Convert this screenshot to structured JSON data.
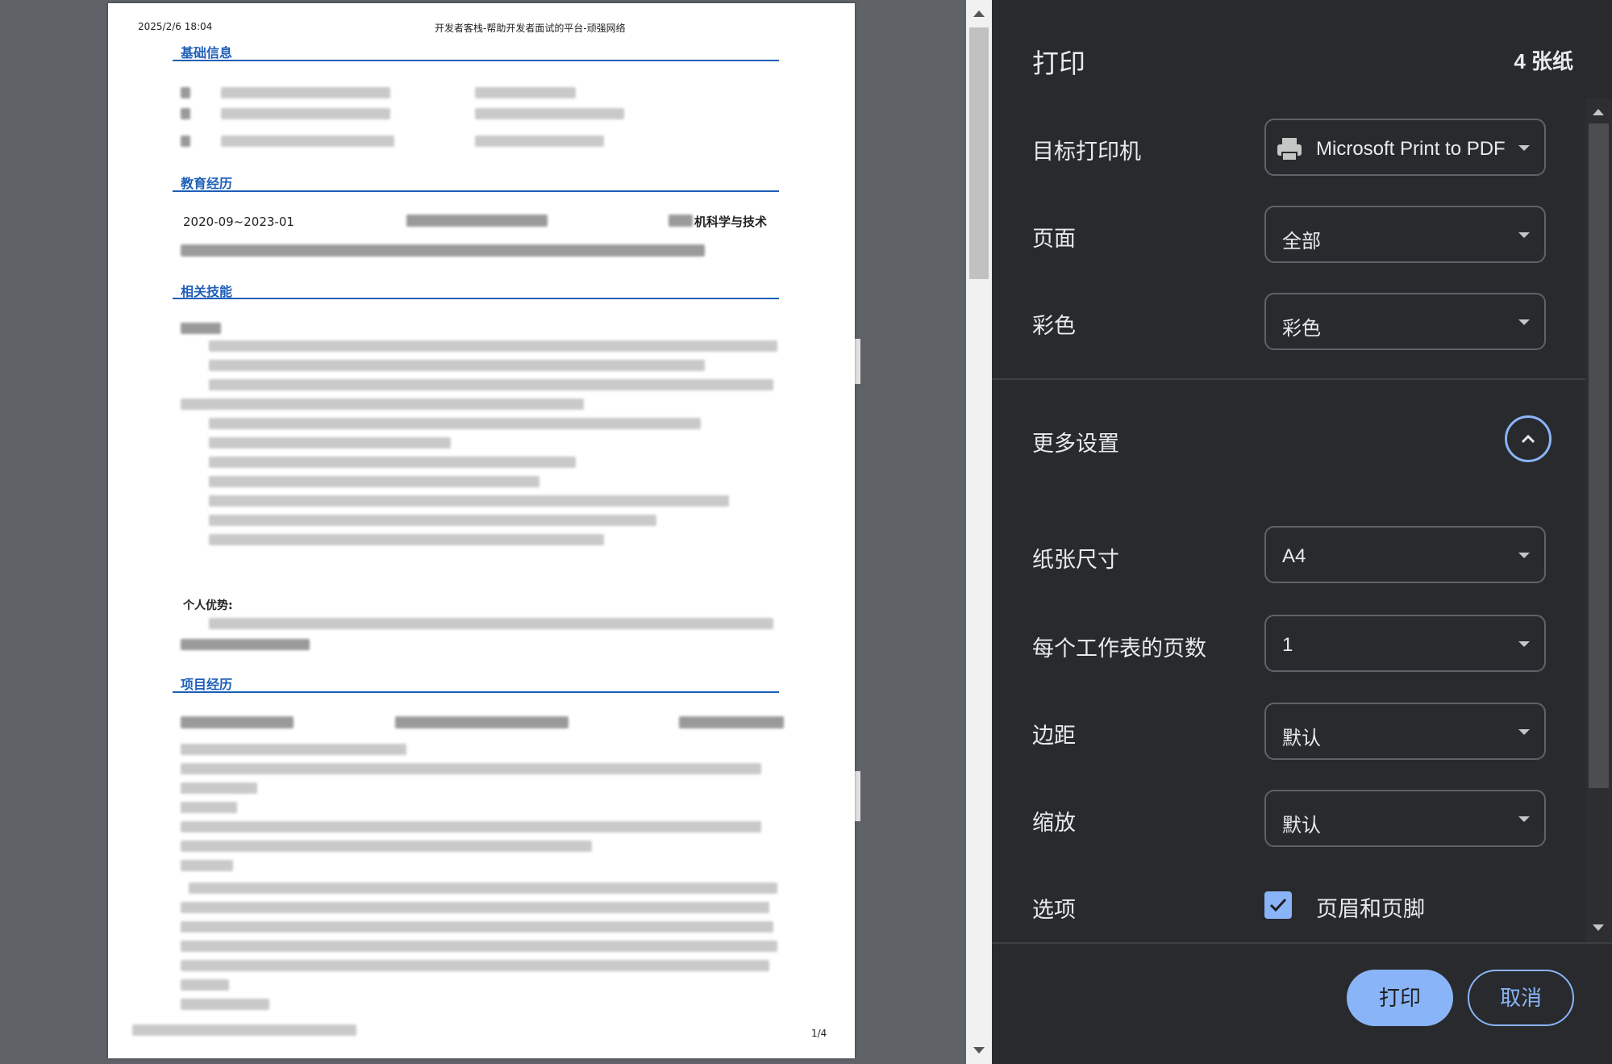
{
  "preview": {
    "header_date": "2025/2/6 18:04",
    "header_title": "开发者客栈-帮助开发者面试的平台-顽强网络",
    "page_number": "1/4",
    "sections": {
      "basic": "基础信息",
      "education": "教育经历",
      "skills": "相关技能",
      "projects": "项目经历"
    },
    "edu_date": "2020-09~2023-01",
    "edu_major": "机科学与技术",
    "advantage_label": "个人优势:"
  },
  "panel": {
    "title": "打印",
    "sheet_count": "4 张纸",
    "destination": {
      "label": "目标打印机",
      "value": "Microsoft Print to PDF",
      "icon": "printer-icon"
    },
    "pages": {
      "label": "页面",
      "value": "全部"
    },
    "color": {
      "label": "彩色",
      "value": "彩色"
    },
    "more_settings": {
      "label": "更多设置",
      "icon": "chevron-up-icon"
    },
    "paper_size": {
      "label": "纸张尺寸",
      "value": "A4"
    },
    "pages_per_sheet": {
      "label": "每个工作表的页数",
      "value": "1"
    },
    "margins": {
      "label": "边距",
      "value": "默认"
    },
    "scale": {
      "label": "缩放",
      "value": "默认"
    },
    "options": {
      "label": "选项",
      "checkbox_label": "页眉和页脚",
      "checked": true
    },
    "buttons": {
      "print": "打印",
      "cancel": "取消"
    }
  },
  "colors": {
    "accent": "#8ab4f8",
    "panel_bg": "#292a2d",
    "section_blue": "#1d5fb8",
    "preview_bg": "#5f6368"
  }
}
